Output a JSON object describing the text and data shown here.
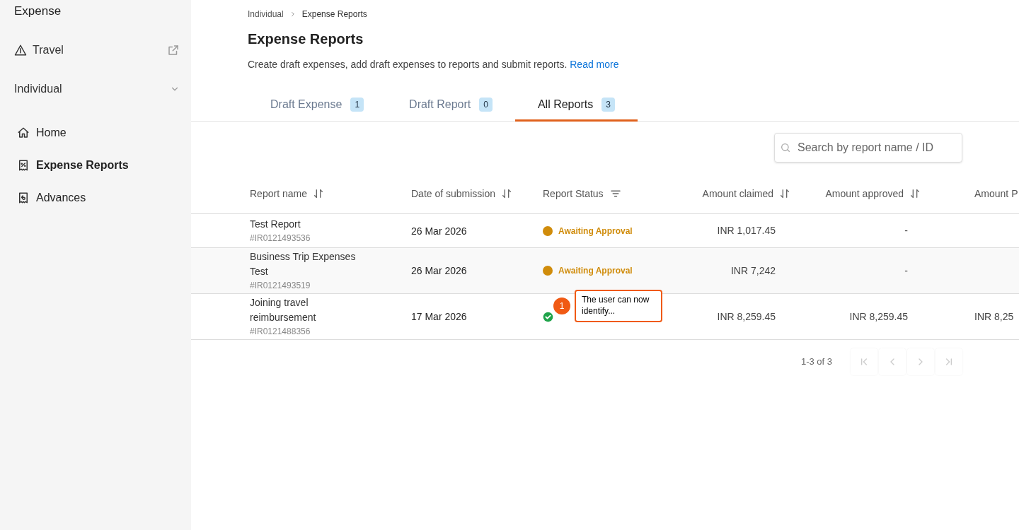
{
  "sidebar": {
    "title": "Expense",
    "travel": {
      "label": "Travel"
    },
    "section": {
      "label": "Individual",
      "expanded": true
    },
    "items": [
      {
        "label": "Home",
        "selected": false
      },
      {
        "label": "Expense Reports",
        "selected": true
      },
      {
        "label": "Advances",
        "selected": false
      }
    ]
  },
  "breadcrumb": [
    "Individual",
    "Expense Reports"
  ],
  "page": {
    "title": "Expense Reports",
    "description": "Create draft expenses, add draft expenses to reports and submit reports.",
    "link": "Read more"
  },
  "tabs": [
    {
      "label": "Draft Expense",
      "count": "1",
      "selected": false
    },
    {
      "label": "Draft Report",
      "count": "0",
      "selected": false
    },
    {
      "label": "All Reports",
      "count": "3",
      "selected": true
    }
  ],
  "search": {
    "placeholder": "Search by report name / ID"
  },
  "table": {
    "columns": [
      {
        "label": "Report name"
      },
      {
        "label": "Date of submission"
      },
      {
        "label": "Report Status"
      },
      {
        "label": "Amount claimed"
      },
      {
        "label": "Amount approved"
      },
      {
        "label": "Amount P"
      }
    ],
    "rows": [
      {
        "name": "Test Report",
        "id": "#IR0121493536",
        "date": "26 Mar 2026",
        "status": {
          "kind": "pending",
          "label": "Awaiting Approval"
        },
        "claimed": "INR 1,017.45",
        "approved": "-"
      },
      {
        "name": "Business Trip Expenses Test",
        "id": "#IR0121493519",
        "date": "26 Mar 2026",
        "status": {
          "kind": "pending",
          "label": "Awaiting Approval"
        },
        "claimed": "INR 7,242",
        "approved": "-"
      },
      {
        "name": "Joining travel reimbursement",
        "id": "#IR0121488356",
        "date": "17 Mar 2026",
        "status": {
          "kind": "approved"
        },
        "claimed": "INR 8,259.45",
        "approved": "INR 8,259.45",
        "column_6": "INR 8,25"
      }
    ]
  },
  "annotation": {
    "number": "1",
    "text": "The user can now identify..."
  },
  "pagination": {
    "range": "1-3 of 3",
    "buttons": [
      {
        "kind": "first",
        "disabled": true
      },
      {
        "kind": "prev",
        "disabled": true
      },
      {
        "kind": "next",
        "disabled": true
      },
      {
        "kind": "last",
        "disabled": true
      }
    ]
  }
}
